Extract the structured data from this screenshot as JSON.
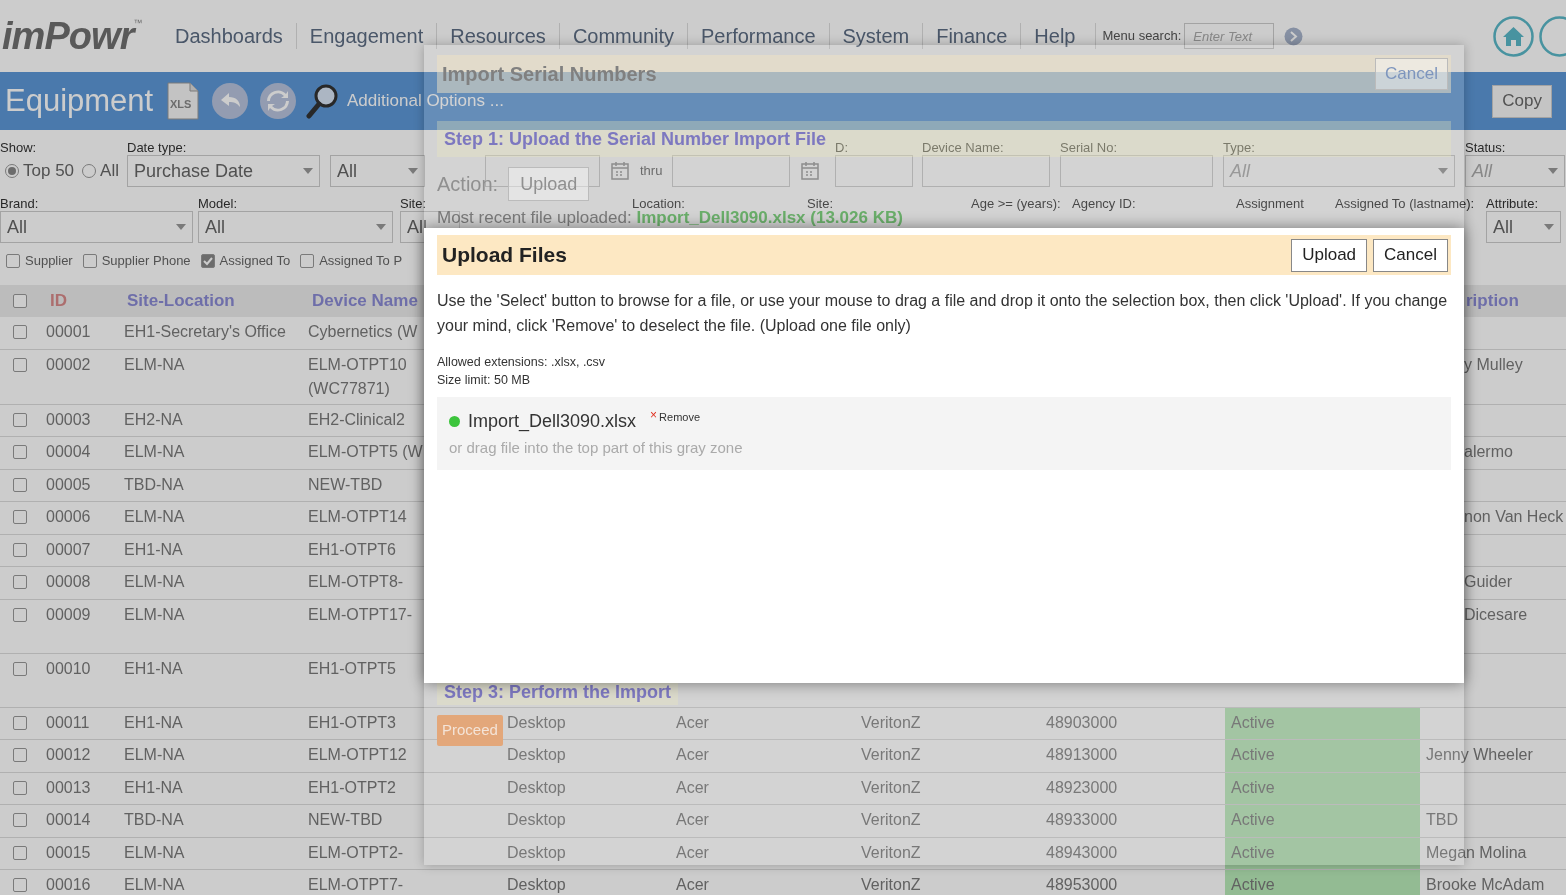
{
  "nav": {
    "logo": "imPowr",
    "logo_mark": "™",
    "items": [
      "Dashboards",
      "Engagement",
      "Resources",
      "Community",
      "Performance",
      "System",
      "Finance",
      "Help"
    ],
    "search_label": "Menu search:",
    "search_placeholder": "Enter Text"
  },
  "header": {
    "title": "Equipment",
    "export_label": "XLS",
    "options_link": "Additional Options ...",
    "copy_button": "Copy"
  },
  "filters": {
    "show_label": "Show:",
    "show_options": [
      {
        "label": "Top 50",
        "selected": true
      },
      {
        "label": "All",
        "selected": false
      }
    ],
    "date_type_label": "Date type:",
    "date_type": "Purchase Date",
    "date_range": "All",
    "thru": "thru",
    "id_label": "D:",
    "device_name_label": "Device Name:",
    "serial_no_label": "Serial No:",
    "type_label": "Type:",
    "type": "All",
    "status_label": "Status:",
    "status": "All",
    "brand_label": "Brand:",
    "brand": "All",
    "model_label": "Model:",
    "model": "All",
    "site_label": "Site:",
    "site": "All",
    "location_label": "Location:",
    "site2_label": "Site:",
    "age_label": "Age >= (years):",
    "agency_label": "Agency ID:",
    "assignment_label": "Assignment",
    "assigned_to_label": "Assigned To (lastname):",
    "attribute_label": "Attribute:",
    "attribute": "All",
    "columns": [
      {
        "label": "Supplier",
        "checked": false
      },
      {
        "label": "Supplier Phone",
        "checked": false
      },
      {
        "label": "Assigned To",
        "checked": true
      },
      {
        "label": "Assigned To P",
        "checked": false
      }
    ]
  },
  "table": {
    "columns": [
      "ID",
      "Site-Location",
      "Device Name",
      "ription"
    ],
    "header_checked": false,
    "rows": [
      {
        "id": "00001",
        "site": "EH1-Secretary's Office",
        "device": "Cybernetics (W",
        "checked": false
      },
      {
        "id": "00002",
        "site": "ELM-NA",
        "device": "ELM-OTPT10 (WC77871)",
        "assigned": "y Mulley",
        "checked": false
      },
      {
        "id": "00003",
        "site": "EH2-NA",
        "device": "EH2-Clinical2",
        "checked": false
      },
      {
        "id": "00004",
        "site": "ELM-NA",
        "device": "ELM-OTPT5 (W",
        "assigned": "alermo",
        "checked": false
      },
      {
        "id": "00005",
        "site": "TBD-NA",
        "device": "NEW-TBD",
        "checked": false
      },
      {
        "id": "00006",
        "site": "ELM-NA",
        "device": "ELM-OTPT14",
        "assigned": "non Van Heck",
        "checked": false
      },
      {
        "id": "00007",
        "site": "EH1-NA",
        "device": "EH1-OTPT6",
        "checked": false
      },
      {
        "id": "00008",
        "site": "ELM-NA",
        "device": "ELM-OTPT8-",
        "assigned": "Guider",
        "checked": false
      },
      {
        "id": "00009",
        "site": "ELM-NA",
        "device": "ELM-OTPT17-",
        "assigned": "Dicesare",
        "tall": true,
        "checked": false
      },
      {
        "id": "00010",
        "site": "EH1-NA",
        "device": "EH1-OTPT5",
        "tall": true,
        "checked": false
      },
      {
        "id": "00011",
        "site": "EH1-NA",
        "device": "EH1-OTPT3",
        "type": "Desktop",
        "brand": "Acer",
        "model": "VeritonZ",
        "serial": "48903000",
        "status": "Active",
        "checked": false
      },
      {
        "id": "00012",
        "site": "ELM-NA",
        "device": "ELM-OTPT12",
        "type": "Desktop",
        "brand": "Acer",
        "model": "VeritonZ",
        "serial": "48913000",
        "status": "Active",
        "assigned": "Jenny Wheeler",
        "checked": false
      },
      {
        "id": "00013",
        "site": "EH1-NA",
        "device": "EH1-OTPT2",
        "type": "Desktop",
        "brand": "Acer",
        "model": "VeritonZ",
        "serial": "48923000",
        "status": "Active",
        "checked": false
      },
      {
        "id": "00014",
        "site": "TBD-NA",
        "device": "NEW-TBD",
        "type": "Desktop",
        "brand": "Acer",
        "model": "VeritonZ",
        "serial": "48933000",
        "status": "Active",
        "assigned": "TBD",
        "checked": false
      },
      {
        "id": "00015",
        "site": "ELM-NA",
        "device": "ELM-OTPT2-",
        "type": "Desktop",
        "brand": "Acer",
        "model": "VeritonZ",
        "serial": "48943000",
        "status": "Active",
        "assigned": "Megan Molina",
        "checked": false
      },
      {
        "id": "00016",
        "site": "ELM-NA",
        "device": "ELM-OTPT7-",
        "type": "Desktop",
        "brand": "Acer",
        "model": "VeritonZ",
        "serial": "48953000",
        "status": "Active",
        "assigned": "Brooke McAdam",
        "checked": false
      }
    ]
  },
  "import_dialog": {
    "title": "Import Serial Numbers",
    "cancel": "Cancel",
    "step1": "Step 1: Upload the Serial Number Import File",
    "action_label": "Action:",
    "action_button": "Upload",
    "recent": "Most recent file uploaded: **Import_Dell3090.xlsx (13.026 KB)**",
    "step3": "Step 3: Perform the Import",
    "proceed": "Proceed"
  },
  "upload_dialog": {
    "title": "Upload Files",
    "buttons": [
      "Upload",
      "Cancel"
    ],
    "instructions": "Use the 'Select' button to browse for a file, or use your mouse to drag a file and drop it onto the selection box, then click 'Upload'. If you change your mind, click 'Remove' to deselect the file.  (Upload one file only)",
    "extensions": "Allowed extensions: .xlsx, .csv",
    "size_limit": "Size limit: 50 MB",
    "file": {
      "name": "Import_Dell3090.xlsx",
      "remove_icon": "×",
      "remove_label": "Remove"
    },
    "drop_hint": "or drag file into the top part of this gray zone"
  }
}
